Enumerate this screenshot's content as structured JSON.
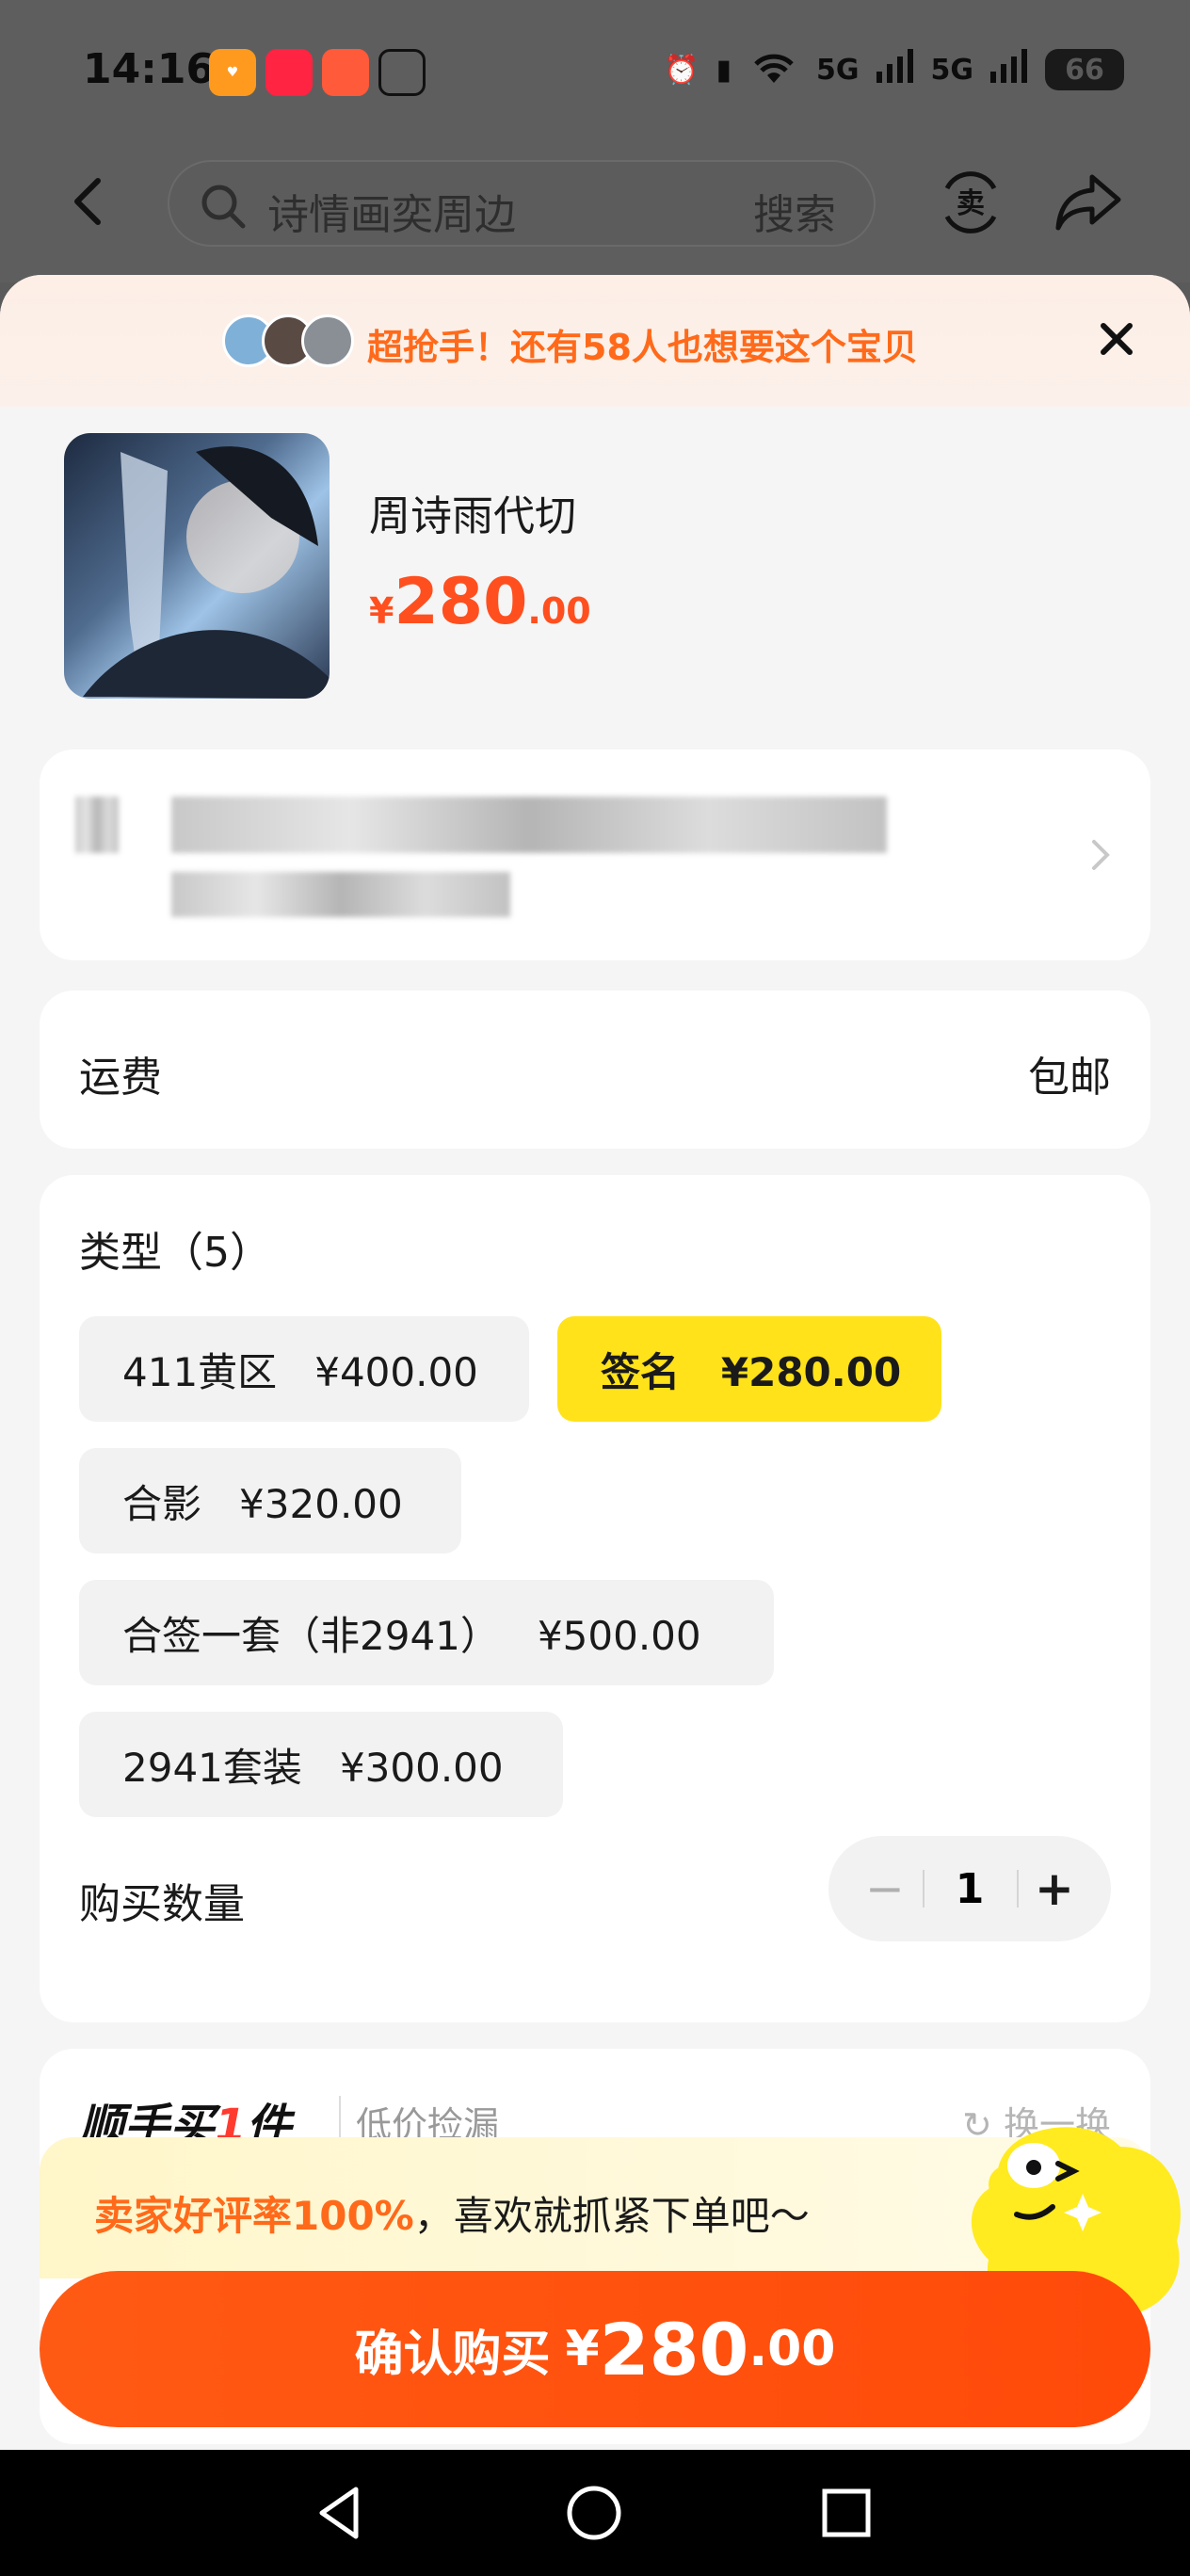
{
  "status_bar": {
    "time": "14:16",
    "battery": "66",
    "signal_1": "5G",
    "signal_2": "5G"
  },
  "search": {
    "placeholder": "诗情画奕周边",
    "button_label": "搜索"
  },
  "promo": {
    "text": "超抢手！还有58人也想要这个宝贝"
  },
  "product": {
    "name": "周诗雨代切",
    "price_symbol": "¥",
    "price_int": "280",
    "price_dec": ".00"
  },
  "shipping": {
    "label": "运费",
    "value": "包邮"
  },
  "types": {
    "title": "类型（5）",
    "options": [
      {
        "label": "411黄区   ¥400.00",
        "selected": false
      },
      {
        "label": "签名   ¥280.00",
        "selected": true
      },
      {
        "label": "合影   ¥320.00",
        "selected": false
      },
      {
        "label": "合签一套（非2941）   ¥500.00",
        "selected": false
      },
      {
        "label": "2941套装   ¥300.00",
        "selected": false
      }
    ]
  },
  "quantity": {
    "label": "购买数量",
    "value": "1",
    "minus": "−",
    "plus": "+"
  },
  "extra": {
    "title_prefix": "顺手买",
    "title_num": "1",
    "title_suffix": "件",
    "subtitle": "低价捡漏",
    "refresh": "换一换"
  },
  "rating": {
    "highlight": "卖家好评率100%",
    "rest": "，喜欢就抓紧下单吧～"
  },
  "confirm": {
    "label": "确认购买",
    "symbol": "¥",
    "int": "280",
    "dec": ".00"
  },
  "colors": {
    "accent": "#ff4f1f",
    "selected_option": "#ffe21a",
    "button": "#ff5a14"
  },
  "icons": [
    "back-icon",
    "search-icon",
    "sell-icon",
    "share-icon",
    "close-icon",
    "chevron-right-icon",
    "refresh-icon",
    "nav-back-icon",
    "nav-home-icon",
    "nav-recents-icon"
  ]
}
